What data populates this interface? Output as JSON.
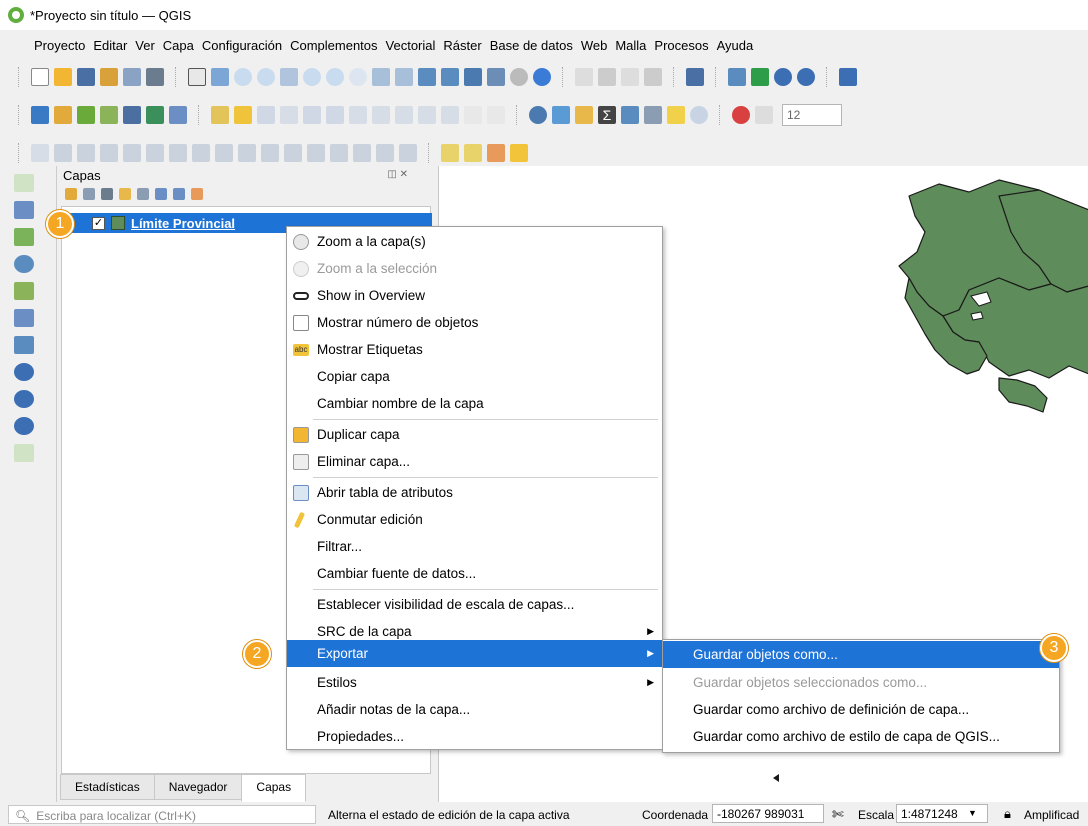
{
  "window": {
    "title": "*Proyecto sin título — QGIS"
  },
  "menubar": [
    "Proyecto",
    "Editar",
    "Ver",
    "Capa",
    "Configuración",
    "Complementos",
    "Vectorial",
    "Ráster",
    "Base de datos",
    "Web",
    "Malla",
    "Procesos",
    "Ayuda"
  ],
  "toolbar": {
    "font_size_value": "12"
  },
  "layers_panel": {
    "title": "Capas",
    "layer": {
      "name": "Límite Provincial",
      "checked": "✓",
      "color": "#5e8c5a"
    },
    "tabs": [
      "Estadísticas",
      "Navegador",
      "Capas"
    ]
  },
  "context_menu": {
    "items": [
      "Zoom a la capa(s)",
      "Zoom a la selección",
      "Show in Overview",
      "Mostrar número de objetos",
      "Mostrar Etiquetas",
      "Copiar capa",
      "Cambiar nombre de la capa",
      "Duplicar capa",
      "Eliminar capa...",
      "Abrir tabla de atributos",
      "Conmutar edición",
      "Filtrar...",
      "Cambiar fuente de datos...",
      "Establecer visibilidad de escala de capas...",
      "SRC de la capa",
      "Exportar",
      "Estilos",
      "Añadir notas de la capa...",
      "Propiedades..."
    ],
    "labels_icon_text": "abc"
  },
  "export_submenu": {
    "items": [
      "Guardar objetos como...",
      "Guardar objetos seleccionados como...",
      "Guardar como archivo de definición de capa...",
      "Guardar como archivo de estilo de capa de QGIS..."
    ]
  },
  "badges": [
    "1",
    "2",
    "3"
  ],
  "statusbar": {
    "locator_placeholder": "Escriba para localizar (Ctrl+K)",
    "message": "Alterna el estado de edición de la capa activa",
    "coord_label": "Coordenada",
    "coord_value": "-180267 989031",
    "scale_label": "Escala",
    "scale_value": "1:4871248",
    "magnifier_label": "Amplificad"
  },
  "colors": {
    "accent": "#1e73d6",
    "badge": "#f5a623",
    "map_fill": "#5e8c5a"
  }
}
